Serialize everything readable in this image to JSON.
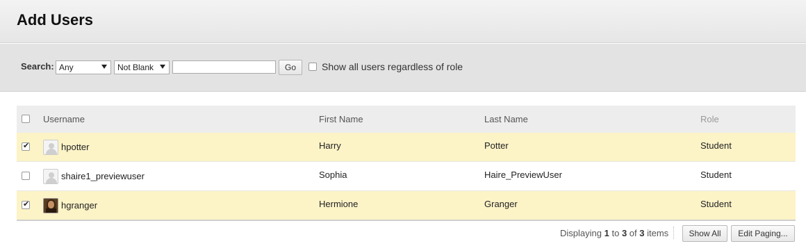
{
  "page": {
    "title": "Add Users"
  },
  "search": {
    "label": "Search:",
    "field_select": "Any",
    "operator_select": "Not Blank",
    "query_value": "",
    "go_label": "Go",
    "show_all_label": "Show all users regardless of role",
    "show_all_checked": false
  },
  "table": {
    "headers": {
      "username": "Username",
      "first_name": "First Name",
      "last_name": "Last Name",
      "role": "Role"
    },
    "rows": [
      {
        "checked": true,
        "avatar": "default-avatar-icon",
        "username": "hpotter",
        "first_name": "Harry",
        "last_name": "Potter",
        "role": "Student"
      },
      {
        "checked": false,
        "avatar": "default-avatar-icon",
        "username": "shaire1_previewuser",
        "first_name": "Sophia",
        "last_name": "Haire_PreviewUser",
        "role": "Student"
      },
      {
        "checked": true,
        "avatar": "photo-avatar",
        "username": "hgranger",
        "first_name": "Hermione",
        "last_name": "Granger",
        "role": "Student"
      }
    ]
  },
  "paging": {
    "prefix": "Displaying",
    "from": "1",
    "to_word": "to",
    "to": "3",
    "of_word": "of",
    "total": "3",
    "suffix": "items",
    "show_all_label": "Show All",
    "edit_paging_label": "Edit Paging..."
  }
}
